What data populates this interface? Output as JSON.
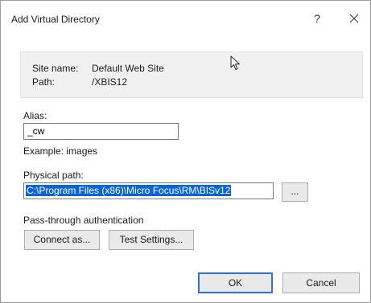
{
  "dialog": {
    "title": "Add Virtual Directory",
    "help_glyph": "?",
    "close_glyph": "✕"
  },
  "info": {
    "site_name_label": "Site name:",
    "site_name_value": "Default Web Site",
    "path_label": "Path:",
    "path_value": "/XBIS12"
  },
  "alias": {
    "label": "Alias:",
    "value": "_cw",
    "example": "Example: images"
  },
  "physical_path": {
    "label": "Physical path:",
    "value": "C:\\Program Files (x86)\\Micro Focus\\RM\\BISv12",
    "browse_label": "..."
  },
  "auth": {
    "label": "Pass-through authentication",
    "connect_as_label": "Connect as...",
    "test_settings_label": "Test Settings..."
  },
  "footer": {
    "ok_label": "OK",
    "cancel_label": "Cancel"
  },
  "colors": {
    "selection": "#0a64d6",
    "info_box_bg": "#f0f0f0",
    "default_button_border": "#2f72d6"
  },
  "icons": {
    "cursor": "mouse-pointer-icon",
    "close": "close-icon"
  }
}
